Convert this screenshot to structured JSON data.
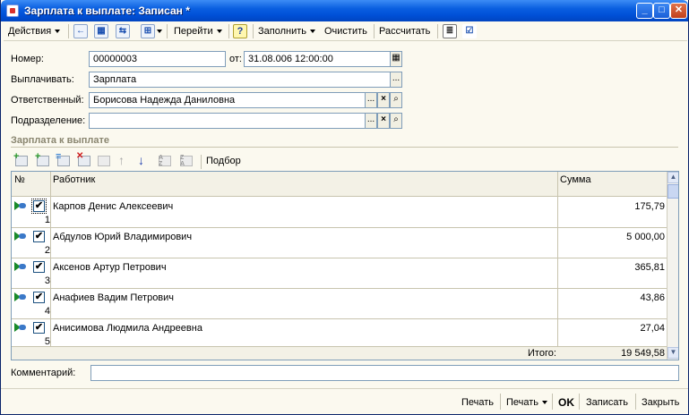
{
  "window": {
    "title": "Зарплата к выплате: Записан *",
    "minimize_glyph": "_",
    "maximize_glyph": "□",
    "close_glyph": "✕"
  },
  "toolbar": {
    "actions_label": "Действия",
    "goto_label": "Перейти",
    "help_glyph": "?",
    "fill_label": "Заполнить",
    "clear_label": "Очистить",
    "calculate_label": "Рассчитать"
  },
  "form": {
    "number_label": "Номер:",
    "number_value": "00000003",
    "date_label": "от:",
    "date_value": "31.08.006  12:00:00",
    "pay_label": "Выплачивать:",
    "pay_value": "Зарплата",
    "responsible_label": "Ответственный:",
    "responsible_value": "Борисова Надежда Даниловна",
    "department_label": "Подразделение:",
    "department_value": "",
    "select_glyph": "...",
    "clear_glyph": "×",
    "open_glyph": "🔍"
  },
  "table_section": {
    "title": "Зарплата к выплате",
    "pick_label": "Подбор"
  },
  "table": {
    "columns": {
      "num": "№",
      "employee": "Работник",
      "sum": "Сумма"
    },
    "rows": [
      {
        "num": "1",
        "employee": "Карпов Денис Алексеевич",
        "sum": "175,79",
        "checked": "✔"
      },
      {
        "num": "2",
        "employee": "Абдулов Юрий Владимирович",
        "sum": "5 000,00",
        "checked": "✔"
      },
      {
        "num": "3",
        "employee": "Аксенов Артур Петрович",
        "sum": "365,81",
        "checked": "✔"
      },
      {
        "num": "4",
        "employee": "Анафиев Вадим Петрович",
        "sum": "43,86",
        "checked": "✔"
      },
      {
        "num": "5",
        "employee": "Анисимова Людмила Андреевна",
        "sum": "27,04",
        "checked": "✔"
      }
    ],
    "total_label": "Итого:",
    "total_value": "19 549,58"
  },
  "comment": {
    "label": "Комментарий:",
    "value": ""
  },
  "bottom": {
    "print_label": "Печать",
    "print_menu_label": "Печать",
    "ok_label": "OK",
    "save_label": "Записать",
    "close_label": "Закрыть"
  }
}
